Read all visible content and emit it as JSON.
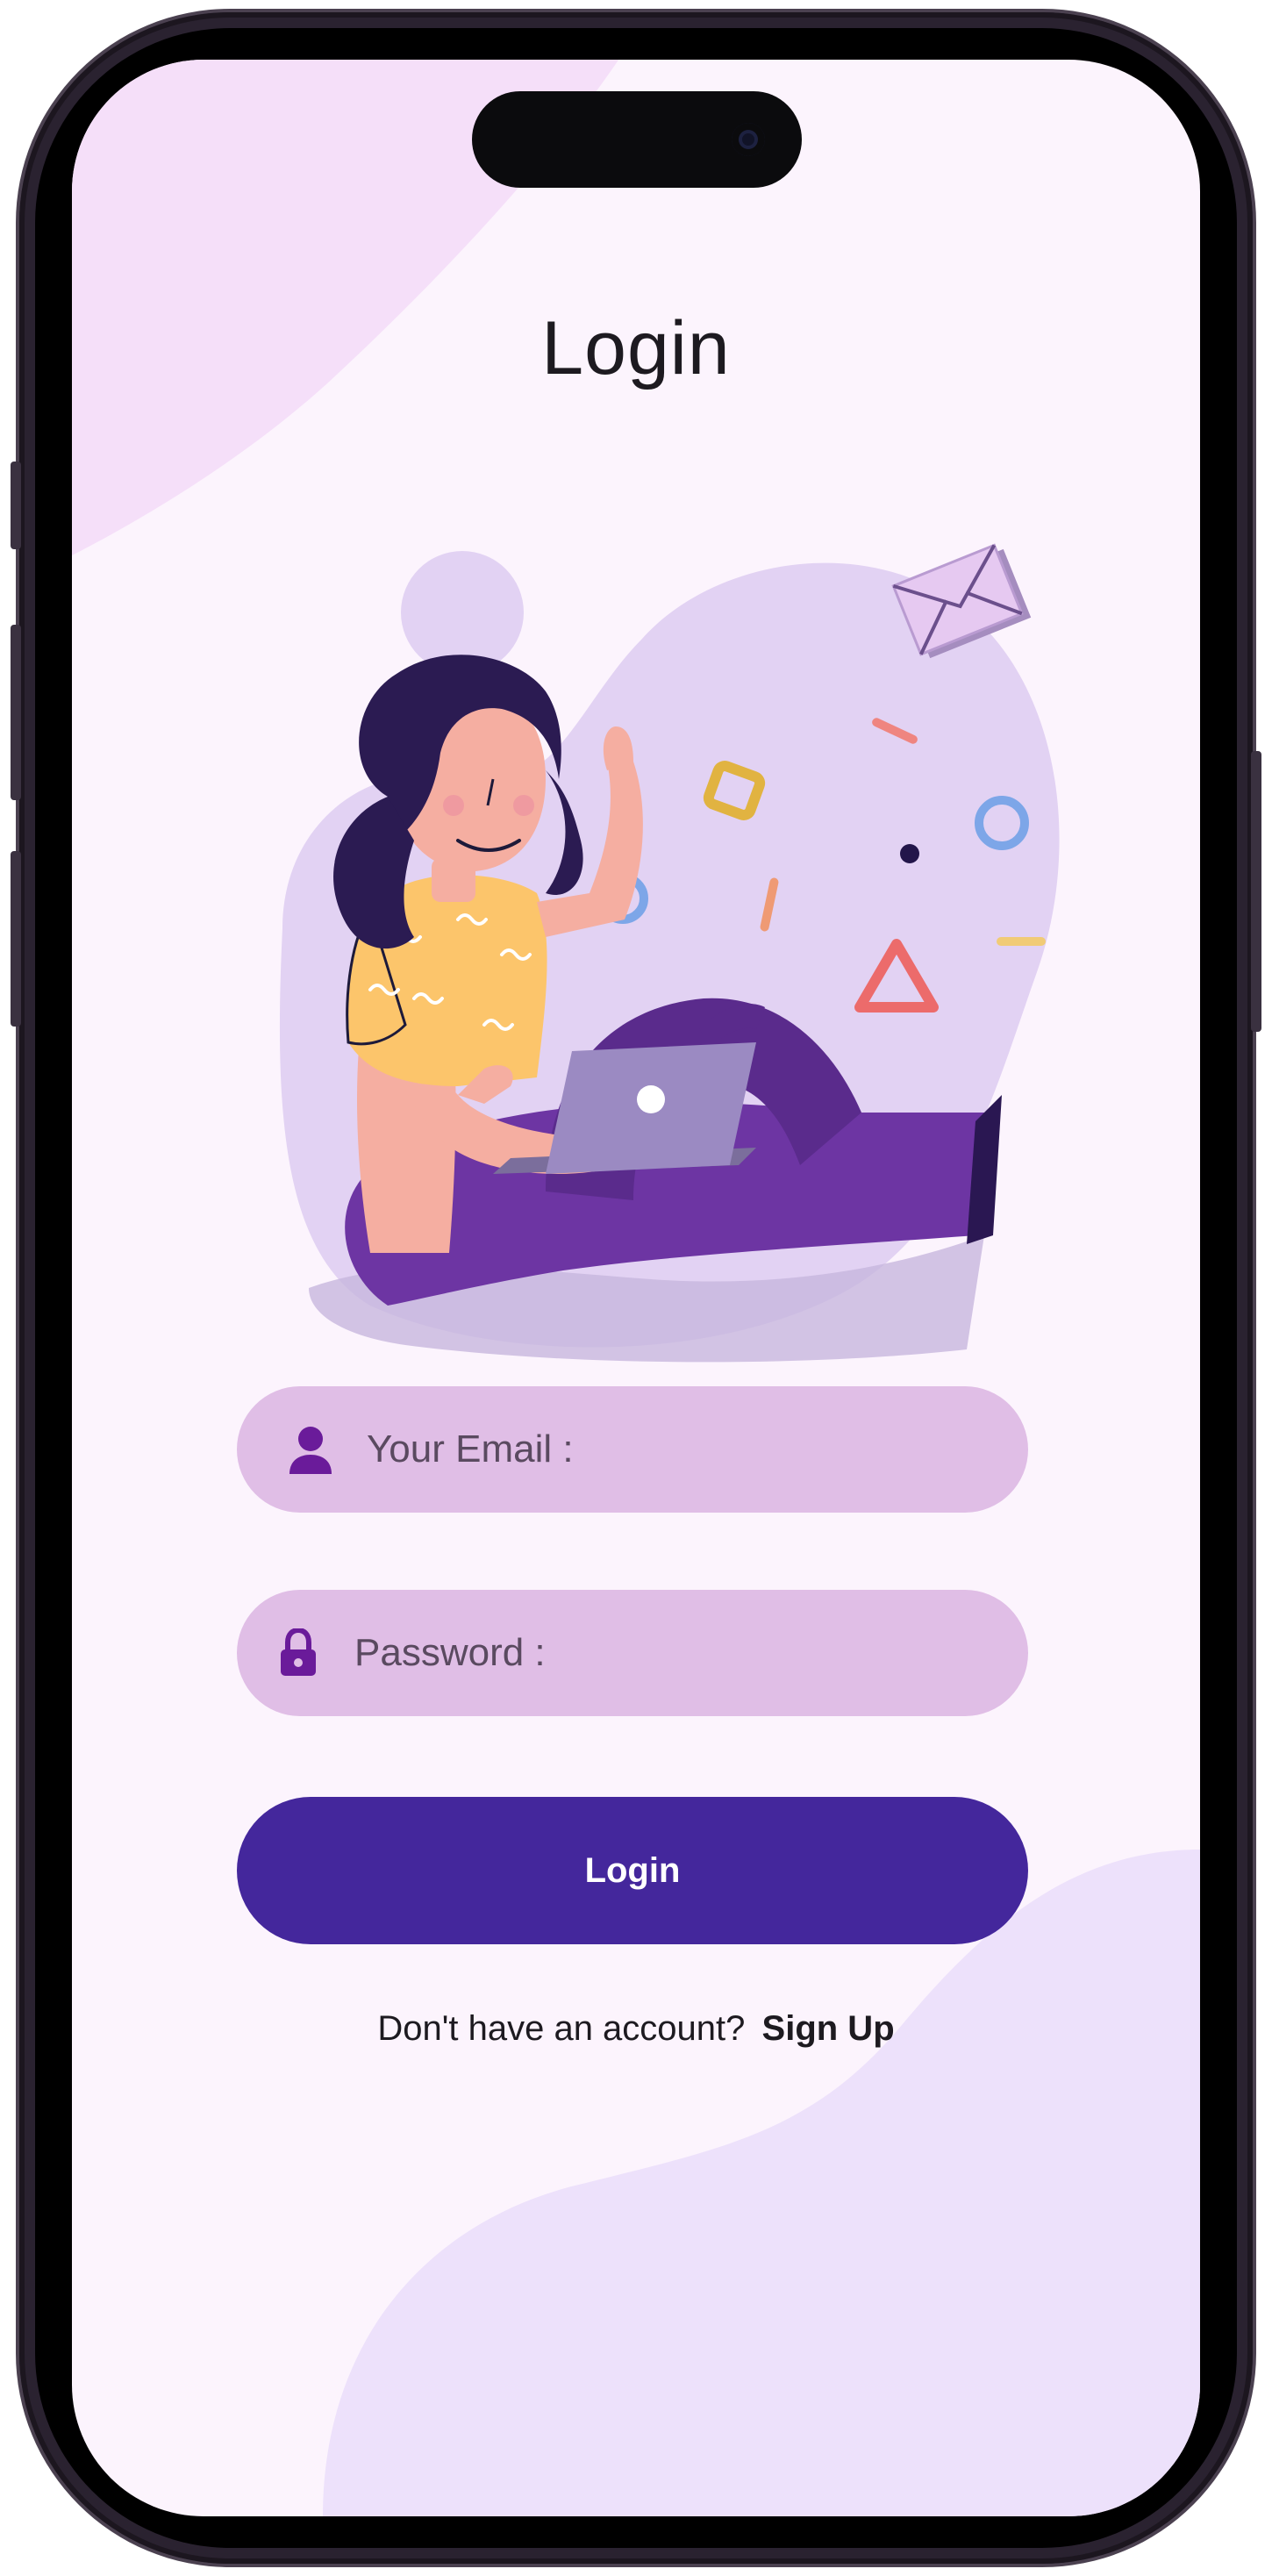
{
  "screen": {
    "title": "Login"
  },
  "form": {
    "email": {
      "placeholder": "Your Email :",
      "value": ""
    },
    "password": {
      "placeholder": "Password :",
      "value": ""
    },
    "login_label": "Login"
  },
  "footer": {
    "prompt": "Don't have an account?",
    "link": "Sign Up"
  },
  "icons": {
    "email": "person-icon",
    "password": "lock-icon"
  },
  "colors": {
    "background": "#fcf4fd",
    "field": "#e0bee6",
    "accent": "#44279c",
    "icon": "#6a1b9a"
  }
}
